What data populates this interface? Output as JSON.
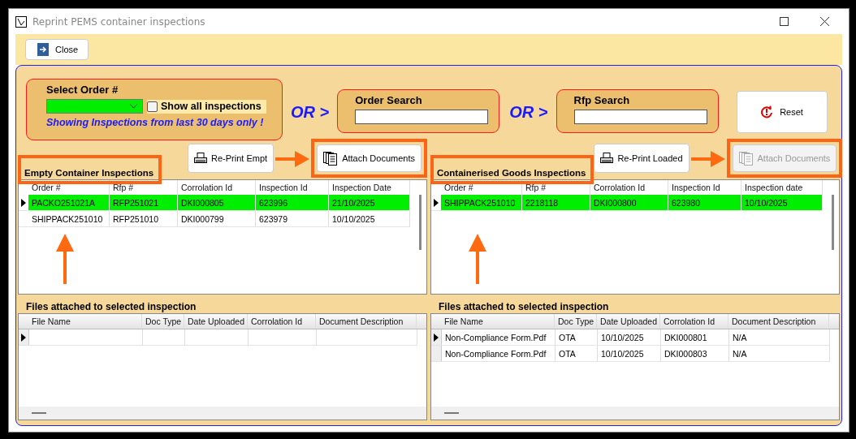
{
  "window": {
    "title": "Reprint PEMS container inspections"
  },
  "toolbar": {
    "close_button": "Close"
  },
  "filters": {
    "select_order": {
      "label": "Select Order #",
      "show_all": {
        "label": "Show all inspections",
        "checked": false
      },
      "notice": "Showing Inspections from last 30 days only !"
    },
    "separators": [
      "OR >",
      "OR >"
    ],
    "order_search": {
      "label": "Order Search"
    },
    "rfp_search": {
      "label": "Rfp Search"
    },
    "reset_button": "Reset"
  },
  "panels": [
    {
      "title": "Empty  Container Inspections",
      "reprint_button": "Re-Print Empt",
      "attach_button": {
        "label": "Attach Documents",
        "disabled": false
      },
      "columns": [
        "Order #",
        "Rfp #",
        "Corrolation Id",
        "Inspection Id",
        "Inspection Date"
      ],
      "rows": [
        {
          "cells": [
            "PACKO251021A",
            "RFP251021",
            "DKI000805",
            "623996",
            "21/10/2025"
          ],
          "selected": true,
          "current": true
        },
        {
          "cells": [
            "SHIPPACK251010",
            "RFP251010",
            "DKI000799",
            "623979",
            "10/10/2025"
          ],
          "selected": false,
          "current": false
        }
      ],
      "files": {
        "title": "Files attached  to selected inspection",
        "columns": [
          "File Name",
          "Doc Type",
          "Date Uploaded",
          "Corrolation Id",
          "Document Description"
        ],
        "new_row": true
      }
    },
    {
      "title": "Containerised Goods Inspections",
      "reprint_button": "Re-Print Loaded",
      "attach_button": {
        "label": "Attach Documents",
        "disabled": true
      },
      "columns": [
        "Order #",
        "Rfp #",
        "Corrolation Id",
        "Inspection Id",
        "Inspection date"
      ],
      "rows": [
        {
          "cells": [
            "SHIPPACK251010",
            "2218118",
            "DKI000800",
            "623980",
            "10/10/2025"
          ],
          "selected": true,
          "current": true
        }
      ],
      "files": {
        "title": "Files attached  to selected inspection",
        "columns": [
          "File Name",
          "Doc Type",
          "Date Uploaded",
          "Corrolation Id",
          "Document Description"
        ],
        "new_row": false,
        "rows": [
          {
            "cells": [
              "Non-Compliance Form.Pdf",
              "OTA",
              "10/10/2025",
              "DKI000801",
              "N/A"
            ],
            "current": true
          },
          {
            "cells": [
              "Non-Compliance Form.Pdf",
              "OTA",
              "10/10/2025",
              "DKI000803",
              "N/A"
            ],
            "current": false
          }
        ]
      }
    }
  ]
}
